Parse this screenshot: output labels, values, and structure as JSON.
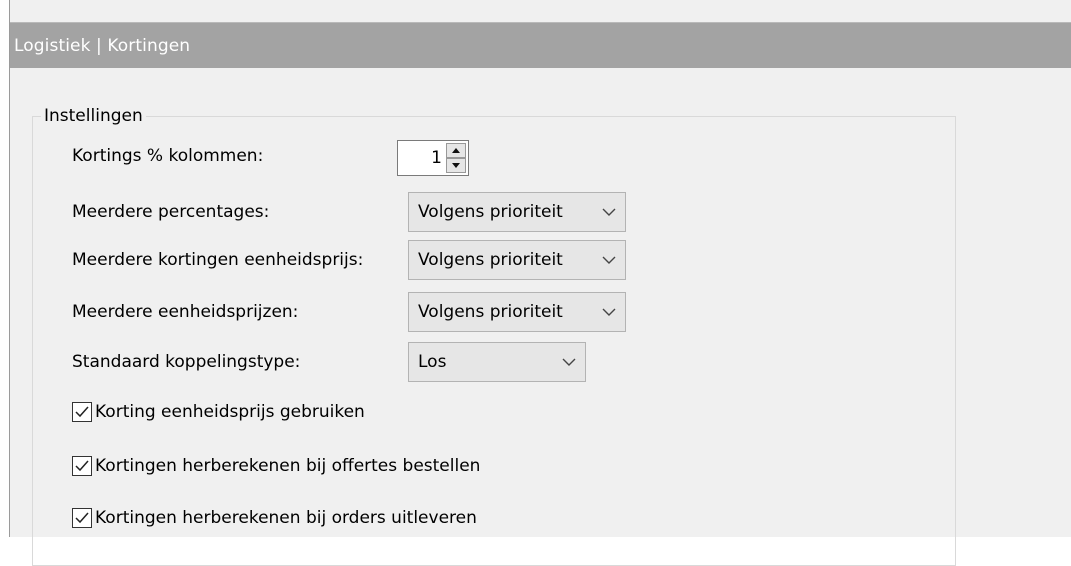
{
  "window": {
    "title": "Logistiek | Kortingen"
  },
  "settings": {
    "group_label": "Instellingen",
    "kortings_kolommen": {
      "label": "Kortings % kolommen:",
      "value": "1"
    },
    "meerdere_percentages": {
      "label": "Meerdere percentages:",
      "value": "Volgens prioriteit"
    },
    "meerdere_kortingen_eenheidsprijs": {
      "label": "Meerdere kortingen eenheidsprijs:",
      "value": "Volgens prioriteit"
    },
    "meerdere_eenheidsprijzen": {
      "label": "Meerdere eenheidsprijzen:",
      "value": "Volgens prioriteit"
    },
    "standaard_koppelingstype": {
      "label": "Standaard koppelingstype:",
      "value": "Los"
    },
    "checkboxes": [
      {
        "label": "Korting eenheidsprijs gebruiken",
        "checked": true
      },
      {
        "label": "Kortingen herberekenen bij offertes bestellen",
        "checked": true
      },
      {
        "label": "Kortingen herberekenen bij orders uitleveren",
        "checked": true
      }
    ]
  },
  "icons": {
    "spin_up": "arrow-up-icon",
    "spin_down": "arrow-down-icon",
    "dropdown": "chevron-down-icon",
    "check": "checkmark-icon"
  },
  "colors": {
    "titlebar_bg": "#a3a3a3",
    "titlebar_text": "#ffffff",
    "window_bg": "#f0f0f0",
    "combo_bg": "#e6e6e6"
  }
}
